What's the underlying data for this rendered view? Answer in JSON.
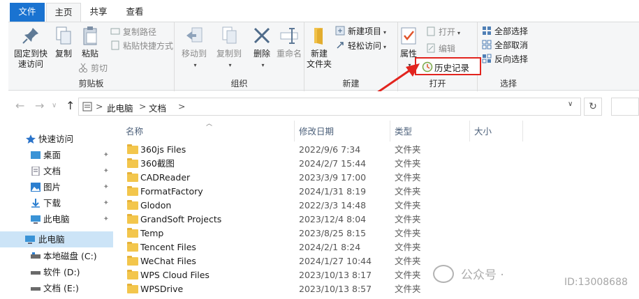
{
  "tabs": {
    "file": "文件",
    "home": "主页",
    "share": "共享",
    "view": "查看"
  },
  "clipboard": {
    "pin": "固定到快速访问",
    "pin_line1": "固定到快",
    "pin_line2": "速访问",
    "copy": "复制",
    "paste": "粘贴",
    "copy_path": "复制路径",
    "paste_shortcut": "粘贴快捷方式",
    "cut": "剪切",
    "label": "剪贴板"
  },
  "organize": {
    "move_to": "移动到",
    "copy_to": "复制到",
    "delete": "删除",
    "rename": "重命名",
    "label": "组织"
  },
  "new": {
    "new_folder_line1": "新建",
    "new_folder_line2": "文件夹",
    "new_item": "新建项目",
    "easy_access": "轻松访问",
    "label": "新建"
  },
  "open": {
    "properties": "属性",
    "open": "打开",
    "edit": "编辑",
    "history": "历史记录",
    "label": "打开"
  },
  "select": {
    "select_all": "全部选择",
    "select_none": "全部取消",
    "invert": "反向选择",
    "label": "选择"
  },
  "address": {
    "crumb1": "此电脑",
    "crumb2": "文档",
    "sep": ">"
  },
  "sidebar": {
    "quick_access": "快速访问",
    "items": [
      "桌面",
      "文档",
      "图片",
      "下载",
      "此电脑"
    ],
    "this_pc": "此电脑",
    "drives": [
      "本地磁盘 (C:)",
      "软件 (D:)",
      "文档 (E:)"
    ]
  },
  "columns": {
    "name": "名称",
    "date": "修改日期",
    "type": "类型",
    "size": "大小"
  },
  "files": [
    {
      "name": "360js Files",
      "date": "2022/9/6 7:34",
      "type": "文件夹"
    },
    {
      "name": "360截图",
      "date": "2024/2/7 15:44",
      "type": "文件夹"
    },
    {
      "name": "CADReader",
      "date": "2023/3/9 17:00",
      "type": "文件夹"
    },
    {
      "name": "FormatFactory",
      "date": "2024/1/31 8:19",
      "type": "文件夹"
    },
    {
      "name": "Glodon",
      "date": "2022/3/3 14:48",
      "type": "文件夹"
    },
    {
      "name": "GrandSoft Projects",
      "date": "2023/12/4 8:04",
      "type": "文件夹"
    },
    {
      "name": "Temp",
      "date": "2023/8/25 8:15",
      "type": "文件夹"
    },
    {
      "name": "Tencent Files",
      "date": "2024/2/1 8:24",
      "type": "文件夹"
    },
    {
      "name": "WeChat Files",
      "date": "2024/1/27 10:44",
      "type": "文件夹"
    },
    {
      "name": "WPS Cloud Files",
      "date": "2023/10/13 8:17",
      "type": "文件夹"
    },
    {
      "name": "WPSDrive",
      "date": "2023/10/13 8:57",
      "type": "文件夹"
    }
  ],
  "watermark": {
    "text": "公众号 ·",
    "id": "ID:13008688"
  },
  "colors": {
    "accent": "#1a73d1",
    "highlight": "#e2241e",
    "folder": "#f3c64c",
    "selected": "#cce4f7"
  }
}
